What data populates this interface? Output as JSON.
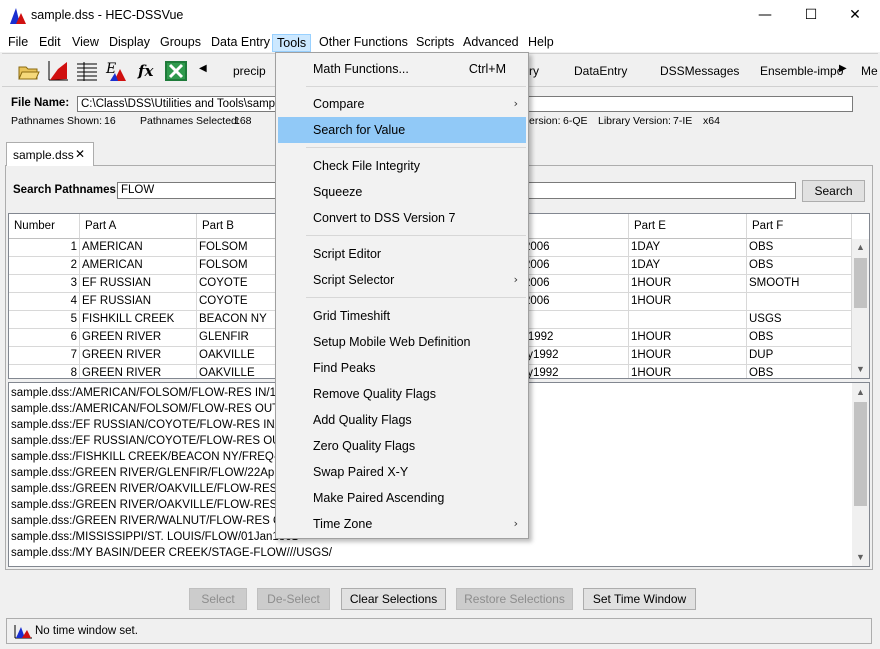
{
  "window": {
    "title": "sample.dss - HEC-DSSVue",
    "minimize": "—",
    "maximize": "☐",
    "close": "✕"
  },
  "menubar": {
    "items": [
      "File",
      "Edit",
      "View",
      "Display",
      "Groups",
      "Data Entry",
      "Tools",
      "Other Functions",
      "Scripts",
      "Advanced",
      "Help"
    ],
    "active": "Tools"
  },
  "toolbar": {
    "tabs": [
      "precip",
      "ry",
      "DataEntry",
      "DSSMessages",
      "Ensemble-impo",
      "Me"
    ],
    "icons": [
      "open-folder-icon",
      "plot-icon",
      "tabulate-icon",
      "edit-data-icon",
      "math-functions-icon",
      "excel-icon",
      "scroll-left-icon",
      "scroll-right-icon"
    ],
    "fx": "fx",
    "left_arrow": "◀",
    "right_arrow": "▶"
  },
  "file_info": {
    "label": "File Name:",
    "path": "C:\\Class\\DSS\\Utilities and Tools\\sample.",
    "pathnames_shown_label": "Pathnames Shown:",
    "pathnames_shown": "16",
    "pathnames_selected_label": "Pathnames Selected:",
    "pathnames_selected": "168",
    "version_label": "ersion:",
    "version": "6-QE",
    "library_label": "Library Version:",
    "library": "7-IE",
    "arch": "x64"
  },
  "tab": {
    "label": "sample.dss",
    "close": "✕"
  },
  "search": {
    "label": "Search Pathnames:",
    "value": "FLOW",
    "button": "Search"
  },
  "table": {
    "columns": [
      "Number",
      "Part A",
      "Part B",
      "Part E",
      "Part F"
    ],
    "rows": [
      {
        "num": "1",
        "a": "AMERICAN",
        "b": "FOLSOM",
        "d": "2006",
        "e": "1DAY",
        "f": "OBS"
      },
      {
        "num": "2",
        "a": "AMERICAN",
        "b": "FOLSOM",
        "d": "2006",
        "e": "1DAY",
        "f": "OBS"
      },
      {
        "num": "3",
        "a": "EF RUSSIAN",
        "b": "COYOTE",
        "d": "2006",
        "e": "1HOUR",
        "f": "SMOOTH"
      },
      {
        "num": "4",
        "a": "EF RUSSIAN",
        "b": "COYOTE",
        "d": "2006",
        "e": "1HOUR",
        "f": ""
      },
      {
        "num": "5",
        "a": "FISHKILL CREEK",
        "b": "BEACON NY",
        "d": "",
        "e": "",
        "f": "USGS"
      },
      {
        "num": "6",
        "a": "GREEN RIVER",
        "b": "GLENFIR",
        "d": "r1992",
        "e": "1HOUR",
        "f": "OBS"
      },
      {
        "num": "7",
        "a": "GREEN RIVER",
        "b": "OAKVILLE",
        "d": "ty1992",
        "e": "1HOUR",
        "f": "DUP"
      },
      {
        "num": "8",
        "a": "GREEN RIVER",
        "b": "OAKVILLE",
        "d": "ty1992",
        "e": "1HOUR",
        "f": "OBS"
      }
    ]
  },
  "pathlist": {
    "lines": [
      "sample.dss:/AMERICAN/FOLSOM/FLOW-RES IN/10Ma",
      "sample.dss:/AMERICAN/FOLSOM/FLOW-RES OUT/10M",
      "sample.dss:/EF RUSSIAN/COYOTE/FLOW-RES IN/01Ma",
      "sample.dss:/EF RUSSIAN/COYOTE/FLOW-RES OUT/01",
      "sample.dss:/FISHKILL CREEK/BEACON NY/FREQ-FLOW",
      "sample.dss:/GREEN RIVER/GLENFIR/FLOW/22Apr1992",
      "sample.dss:/GREEN RIVER/OAKVILLE/FLOW-RES OUT/",
      "sample.dss:/GREEN RIVER/OAKVILLE/FLOW-RES OUT/",
      "sample.dss:/GREEN RIVER/WALNUT/FLOW-RES OUT/2",
      "sample.dss:/MISSISSIPPI/ST. LOUIS/FLOW/01Jan1861",
      "sample.dss:/MY BASIN/DEER CREEK/STAGE-FLOW///USGS/"
    ]
  },
  "buttons": {
    "select": "Select",
    "deselect": "De-Select",
    "clear": "Clear Selections",
    "restore": "Restore Selections",
    "time_window": "Set Time Window"
  },
  "status": {
    "text": "No time window set."
  },
  "tools_menu": {
    "items": [
      {
        "label": "Math Functions...",
        "shortcut": "Ctrl+M"
      },
      {
        "label": "Compare",
        "submenu": "›"
      },
      {
        "label": "Search for Value",
        "highlighted": true
      },
      {
        "label": "Check File Integrity"
      },
      {
        "label": "Squeeze"
      },
      {
        "label": "Convert to DSS Version 7"
      },
      {
        "label": "Script Editor"
      },
      {
        "label": "Script Selector",
        "submenu": "›"
      },
      {
        "label": "Grid Timeshift"
      },
      {
        "label": "Setup Mobile Web Definition"
      },
      {
        "label": "Find Peaks"
      },
      {
        "label": "Remove Quality Flags"
      },
      {
        "label": "Add Quality Flags"
      },
      {
        "label": "Zero Quality Flags"
      },
      {
        "label": "Swap Paired X-Y"
      },
      {
        "label": "Make Paired Ascending"
      },
      {
        "label": "Time Zone",
        "submenu": "›"
      }
    ]
  },
  "colors": {
    "menu_highlight": "#91c9f7",
    "menu_active": "#cce8ff",
    "hec_blue": "#1a2fd0",
    "hec_red": "#d01010"
  }
}
